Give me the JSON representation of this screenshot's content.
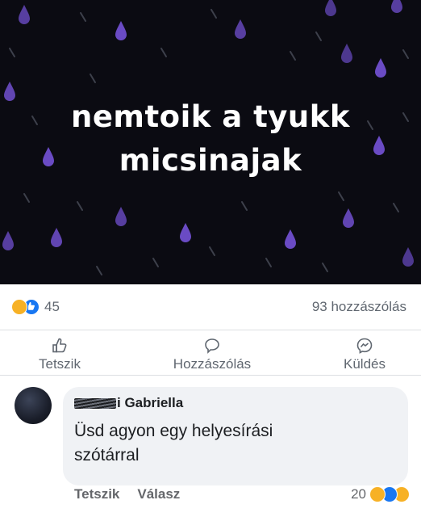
{
  "post": {
    "image_text": "nemtoik a tyukk\nmicsinajak"
  },
  "stats": {
    "reaction_count": "45",
    "comment_count": "93 hozzászólás"
  },
  "actions": {
    "like": "Tetszik",
    "comment": "Hozzászólás",
    "share": "Küldés"
  },
  "comment": {
    "author_visible": "i Gabriella",
    "text": "Üsd agyon egy helyesírási szótárral",
    "like": "Tetszik",
    "reply": "Válasz",
    "reaction_count": "20"
  },
  "colors": {
    "image_background": "#0b0b12",
    "raindrop": "#6a4bc4",
    "like_blue": "#1877f2",
    "haha_yellow": "#f7b125"
  },
  "icons": [
    "thumbs-up-icon",
    "comment-bubble-icon",
    "messenger-icon",
    "haha-reaction-icon",
    "like-reaction-icon",
    "sad-reaction-icon"
  ]
}
